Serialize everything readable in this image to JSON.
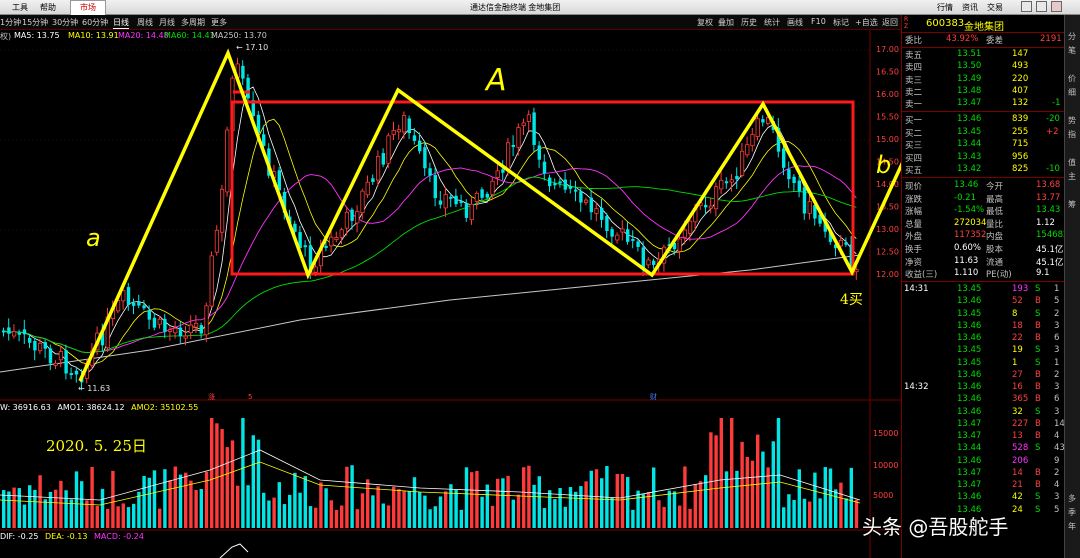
{
  "menu": {
    "tools": "工具",
    "help": "帮助",
    "market_tab": "市场"
  },
  "window_title": "通达信金融终端 金地集团",
  "top_right_menu": {
    "trade": "行情",
    "info": "资讯",
    "exchange": "交易"
  },
  "periods": [
    "1分钟",
    "15分钟",
    "30分钟",
    "60分钟",
    "日线",
    "周线",
    "月线",
    "多周期",
    "更多"
  ],
  "active_period": "日线",
  "toolbar_right": [
    "复权",
    "叠加",
    "历史",
    "统计",
    "画线",
    "F10",
    "标记",
    "+自选",
    "返回"
  ],
  "ma_line": {
    "prefix": "权)",
    "ma5": "MA5: 13.75",
    "ma10": "MA10: 13.91",
    "ma20": "MA20: 14.48",
    "ma60": "MA60: 14.41",
    "ma250": "MA250: 13.70"
  },
  "colors": {
    "up": "#ff3a3a",
    "down": "#00e5e5",
    "ma5": "#ffffff",
    "ma10": "#ffff00",
    "ma20": "#ff33ff",
    "ma60": "#00dd00",
    "ma250": "#c8c8c8",
    "annotation": "#ffff00",
    "box": "#ff1a1a"
  },
  "price_axis": [
    "17.00",
    "16.50",
    "16.00",
    "15.50",
    "15.00",
    "14.50",
    "14.00",
    "13.50",
    "13.00",
    "12.50",
    "12.00"
  ],
  "chart_labels": {
    "high_mark": "17.10",
    "low_mark": "11.63"
  },
  "annotations": {
    "a_left": "a",
    "A_center": "A",
    "b_right": "b",
    "buy4": "4买",
    "date": "2020. 5. 25日"
  },
  "event_markers": [
    "涨",
    "5",
    "财"
  ],
  "volume_line": {
    "prefix": "W: 36916.63",
    "amo1": "AMO1: 38624.12",
    "amo2": "AMO2: 35102.55"
  },
  "volume_axis": [
    "15000",
    "10000",
    "5000"
  ],
  "macd_line": {
    "dif": "DIF: -0.25",
    "dea": "DEA: -0.13",
    "macd": "MACD: -0.24"
  },
  "quote": {
    "code": "600383",
    "name": "金地集团",
    "commission_ratio_label": "委比",
    "commission_ratio": "43.92%",
    "commission_diff_label": "委差",
    "commission_diff": "2191",
    "asks": [
      {
        "label": "卖五",
        "price": "13.51",
        "vol": "147",
        "chg": ""
      },
      {
        "label": "卖四",
        "price": "13.50",
        "vol": "493",
        "chg": ""
      },
      {
        "label": "卖三",
        "price": "13.49",
        "vol": "220",
        "chg": ""
      },
      {
        "label": "卖二",
        "price": "13.48",
        "vol": "407",
        "chg": ""
      },
      {
        "label": "卖一",
        "price": "13.47",
        "vol": "132",
        "chg": "-1"
      }
    ],
    "bids": [
      {
        "label": "买一",
        "price": "13.46",
        "vol": "839",
        "chg": "-20"
      },
      {
        "label": "买二",
        "price": "13.45",
        "vol": "255",
        "chg": "+2"
      },
      {
        "label": "买三",
        "price": "13.44",
        "vol": "715",
        "chg": ""
      },
      {
        "label": "买四",
        "price": "13.43",
        "vol": "956",
        "chg": ""
      },
      {
        "label": "买五",
        "price": "13.42",
        "vol": "825",
        "chg": "-10"
      }
    ],
    "stats": [
      {
        "l1": "现价",
        "v1": "13.46",
        "l2": "今开",
        "v2": "13.68"
      },
      {
        "l1": "涨跌",
        "v1": "-0.21",
        "l2": "最高",
        "v2": "13.77"
      },
      {
        "l1": "涨幅",
        "v1": "-1.54%",
        "l2": "最低",
        "v2": "13.43"
      },
      {
        "l1": "总量",
        "v1": "272034",
        "l2": "量比",
        "v2": "1.12"
      },
      {
        "l1": "外盘",
        "v1": "117352",
        "l2": "内盘",
        "v2": "154682"
      },
      {
        "l1": "换手",
        "v1": "0.60%",
        "l2": "股本",
        "v2": "45.1亿"
      },
      {
        "l1": "净资",
        "v1": "11.63",
        "l2": "流通",
        "v2": "45.1亿"
      },
      {
        "l1": "收益(三)",
        "v1": "1.110",
        "l2": "PE(动)",
        "v2": "9.1"
      }
    ]
  },
  "ticks": [
    {
      "time": "14:31",
      "price": "13.45",
      "vol": "193",
      "side": "S",
      "n": "1"
    },
    {
      "time": "",
      "price": "13.46",
      "vol": "52",
      "side": "B",
      "n": "5"
    },
    {
      "time": "",
      "price": "13.45",
      "vol": "8",
      "side": "S",
      "n": "2"
    },
    {
      "time": "",
      "price": "13.46",
      "vol": "18",
      "side": "B",
      "n": "3"
    },
    {
      "time": "",
      "price": "13.46",
      "vol": "22",
      "side": "B",
      "n": "6"
    },
    {
      "time": "",
      "price": "13.45",
      "vol": "19",
      "side": "S",
      "n": "3"
    },
    {
      "time": "",
      "price": "13.45",
      "vol": "1",
      "side": "S",
      "n": "1"
    },
    {
      "time": "",
      "price": "13.46",
      "vol": "27",
      "side": "B",
      "n": "2"
    },
    {
      "time": "14:32",
      "price": "13.46",
      "vol": "16",
      "side": "B",
      "n": "3"
    },
    {
      "time": "",
      "price": "13.46",
      "vol": "365",
      "side": "B",
      "n": "6"
    },
    {
      "time": "",
      "price": "13.46",
      "vol": "32",
      "side": "S",
      "n": "3"
    },
    {
      "time": "",
      "price": "13.47",
      "vol": "227",
      "side": "B",
      "n": "14"
    },
    {
      "time": "",
      "price": "13.47",
      "vol": "13",
      "side": "B",
      "n": "4"
    },
    {
      "time": "",
      "price": "13.44",
      "vol": "528",
      "side": "S",
      "n": "43"
    },
    {
      "time": "",
      "price": "13.46",
      "vol": "206",
      "side": "",
      "n": "9"
    },
    {
      "time": "",
      "price": "13.47",
      "vol": "14",
      "side": "B",
      "n": "2"
    },
    {
      "time": "",
      "price": "13.47",
      "vol": "21",
      "side": "B",
      "n": "4"
    },
    {
      "time": "",
      "price": "13.46",
      "vol": "42",
      "side": "S",
      "n": "3"
    },
    {
      "time": "",
      "price": "13.46",
      "vol": "24",
      "side": "S",
      "n": "5"
    }
  ],
  "sidebar_tabs": [
    "分",
    "笔",
    "价",
    "细",
    "势",
    "指",
    "值",
    "主",
    "筹",
    "多",
    "季",
    "年"
  ],
  "watermark": "头条 @吾股舵手"
}
